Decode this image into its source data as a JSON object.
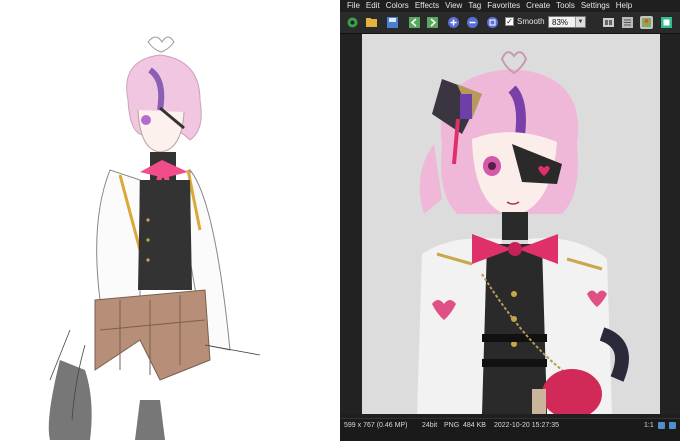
{
  "menu": [
    "File",
    "Edit",
    "Colors",
    "Effects",
    "View",
    "Tag",
    "Favorites",
    "Create",
    "Tools",
    "Settings",
    "Help"
  ],
  "toolbar": {
    "smooth_label": "Smooth",
    "smooth_checked": true,
    "zoom_value": "83%",
    "buttons": [
      "open-icon",
      "folder-icon",
      "save-icon",
      "prev-icon",
      "next-icon",
      "zoom-in-icon",
      "zoom-out-icon",
      "fit-icon",
      "settings-icon",
      "thumbnails-icon",
      "slideshow-icon",
      "fullscreen-icon"
    ]
  },
  "status": {
    "dimensions": "599 x 767 (0.46 MP)",
    "bit_depth": "24bit",
    "format": "PNG",
    "filesize": "484 KB",
    "datetime": "2022-10-20 15:27:35",
    "scale": "1:1"
  },
  "colors": {
    "viewer_bg": "#1f1f1f",
    "canvas_bg": "#dcdcdc",
    "hair": "#f0b8d8",
    "ribbon": "#e0306a",
    "jacket": "#f2f2f2",
    "vest": "#2a2a2a"
  }
}
